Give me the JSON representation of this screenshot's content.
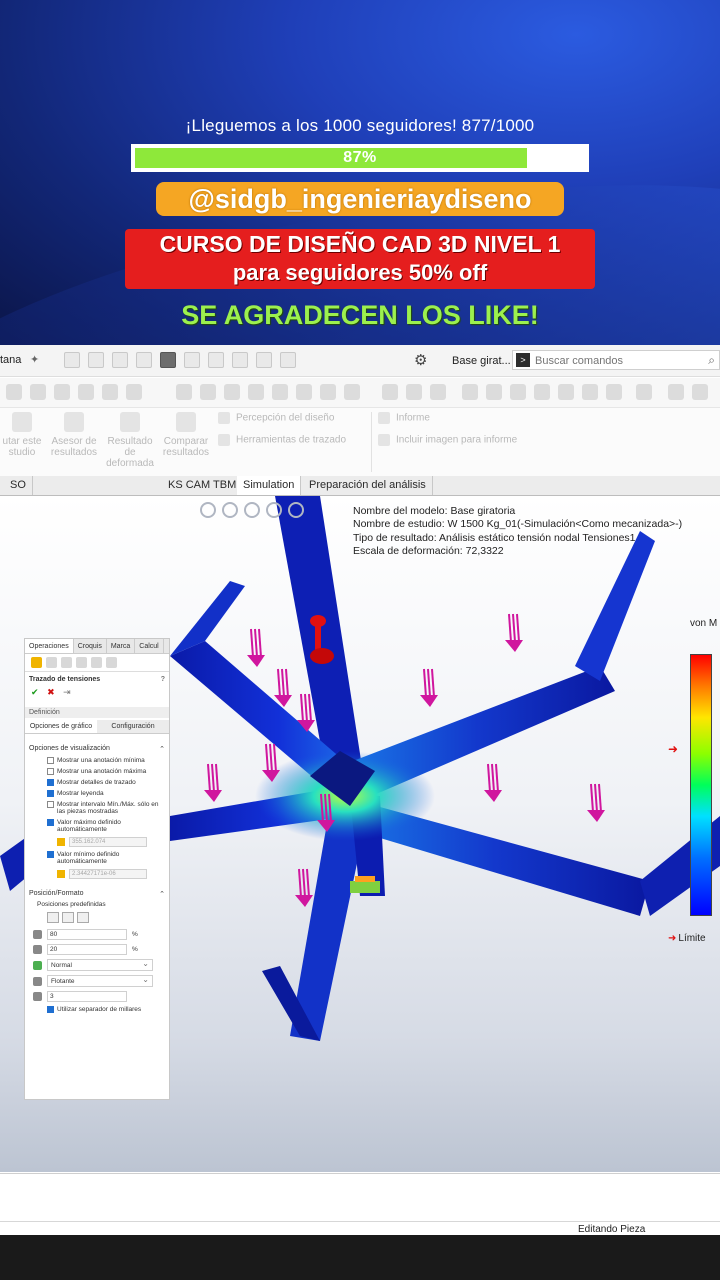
{
  "promo": {
    "goal_text": "¡Lleguemos a los 1000 seguidores!  877/1000",
    "progress_label": "87%",
    "progress_value": 0.87,
    "handle": "@sidgb_ingenieriaydiseno",
    "course_line1": "CURSO DE DISEÑO CAD 3D NIVEL 1",
    "course_line2": "para seguidores 50% off",
    "likes": "SE AGRADECEN LOS LIKE!",
    "colors": {
      "progress_fill": "#8ee83a",
      "handle_bg": "#f5a623",
      "course_bg": "#e51e1e",
      "likes_text": "#9cf04e"
    }
  },
  "menubar": {
    "window_label": "tana",
    "doc_name": "Base girat...",
    "search_placeholder": "Buscar comandos"
  },
  "ribbon": {
    "items": [
      "utar este\nstudio",
      "Asesor de\nresultados",
      "Resultado\nde\ndeformada",
      "Comparar\nresultados"
    ],
    "small_items": [
      "Percepción del diseño",
      "Herramientas de trazado"
    ],
    "report_items": [
      "Informe",
      "Incluir imagen para informe"
    ]
  },
  "tabs": [
    {
      "label": "SO"
    },
    {
      "label": "KS CAM TBM"
    },
    {
      "label": "Simulation",
      "active": true
    },
    {
      "label": "Preparación del análisis"
    }
  ],
  "study_info": {
    "model_name": "Nombre del modelo: Base giratoria",
    "study_name": "Nombre de estudio: W 1500 Kg_01(-Simulación<Como mecanizada>-)",
    "result_type": "Tipo de resultado: Análisis estático tensión nodal Tensiones1",
    "deform_scale": "Escala de deformación: 72,3322"
  },
  "legend": {
    "title": "von M",
    "limit_label": "Límite",
    "colors": [
      "#ff0000",
      "#ff7a00",
      "#ffe600",
      "#8cff00",
      "#00ff5a",
      "#00e0ff",
      "#0070ff",
      "#0000ff"
    ]
  },
  "property_manager": {
    "top_tabs": [
      "Operaciones",
      "Croquis",
      "Marca",
      "Calcul"
    ],
    "title": "Trazado de tensiones",
    "definition_label": "Definición",
    "subtabs": [
      "Opciones de gráfico",
      "Configuración"
    ],
    "display_options_header": "Opciones de visualización",
    "checkboxes": [
      {
        "label": "Mostrar una anotación mínima",
        "checked": false
      },
      {
        "label": "Mostrar una anotación máxima",
        "checked": false
      },
      {
        "label": "Mostrar detalles de trazado",
        "checked": true
      },
      {
        "label": "Mostrar leyenda",
        "checked": true
      },
      {
        "label": "Mostrar intervalo Mín./Máx. sólo en las piezas mostradas",
        "checked": false
      },
      {
        "label": "Valor máximo definido automáticamente",
        "checked": true
      },
      {
        "label": "Valor mínimo definido automáticamente",
        "checked": true
      }
    ],
    "max_value": "355.162.074",
    "min_value": "2.34427171e-06",
    "position_header": "Posición/Formato",
    "preset_label": "Posiciones predefinidas",
    "x_value": "80",
    "y_value": "20",
    "unit_percent": "%",
    "format_select": "Normal",
    "float_select": "Flotante",
    "decimals_value": "3",
    "thousands_label": "Utilizar separador de millares"
  },
  "status": {
    "text": "Editando Pieza"
  }
}
